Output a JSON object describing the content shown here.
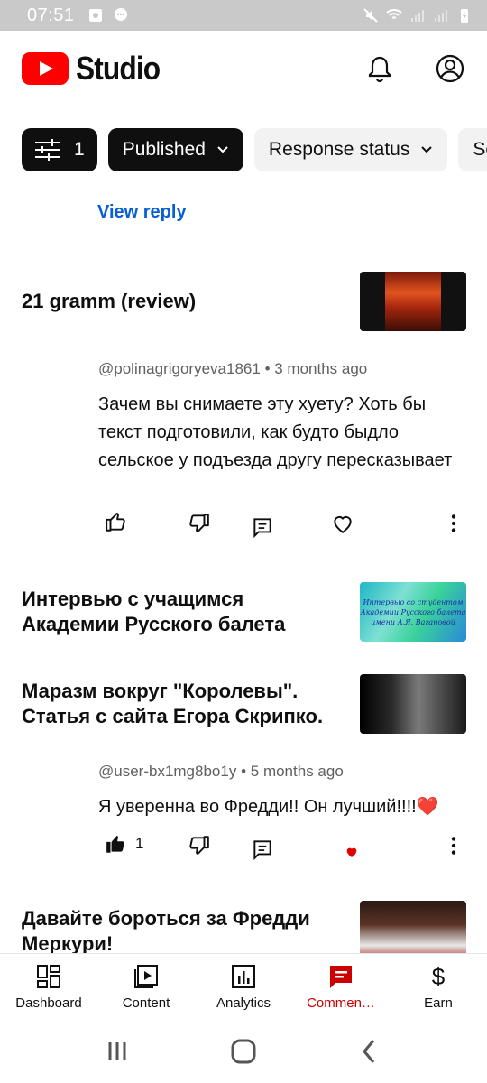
{
  "status_bar": {
    "time": "07:51"
  },
  "header": {
    "app_name": "Studio"
  },
  "filters": [
    {
      "label": "",
      "count": "1"
    },
    {
      "label": "Published"
    },
    {
      "label": "Response status"
    },
    {
      "label": "Se"
    }
  ],
  "view_reply": "View reply",
  "items": [
    {
      "video_title": "21 gramm (review)",
      "comment": {
        "author": "@polinagrigoryeva1861",
        "age": "3 months ago",
        "text": "Зачем вы снимаете эту хуету? Хоть бы текст подготовили, как будто быдло сельское у подъезда другу пересказывает"
      }
    },
    {
      "video_title": "Интервью с учащимся Академии Русского балета",
      "thumbnail_text": "Интервью со студентом Академии Русского балета имени А.Я. Вагановой"
    },
    {
      "video_title": "Маразм вокруг \"Королевы\". Статья с сайта Егора Скрипко.",
      "comment": {
        "author": "@user-bx1mg8bo1y",
        "age": "5 months ago",
        "text": "Я уверенна во Фредди!! Он лучший!!!!❤️",
        "like_count": "1"
      }
    },
    {
      "video_title": "Давайте бороться за Фредди Меркури!"
    }
  ],
  "meta_separator": "•",
  "bottom_nav": [
    {
      "label": "Dashboard",
      "icon": "dashboard-icon"
    },
    {
      "label": "Content",
      "icon": "content-icon"
    },
    {
      "label": "Analytics",
      "icon": "analytics-icon"
    },
    {
      "label": "Commen…",
      "icon": "comments-icon",
      "active": true
    },
    {
      "label": "Earn",
      "icon": "earn-icon"
    }
  ],
  "colors": {
    "accent": "#cc0000",
    "link": "#065fd4",
    "brand": "#ff0000"
  }
}
